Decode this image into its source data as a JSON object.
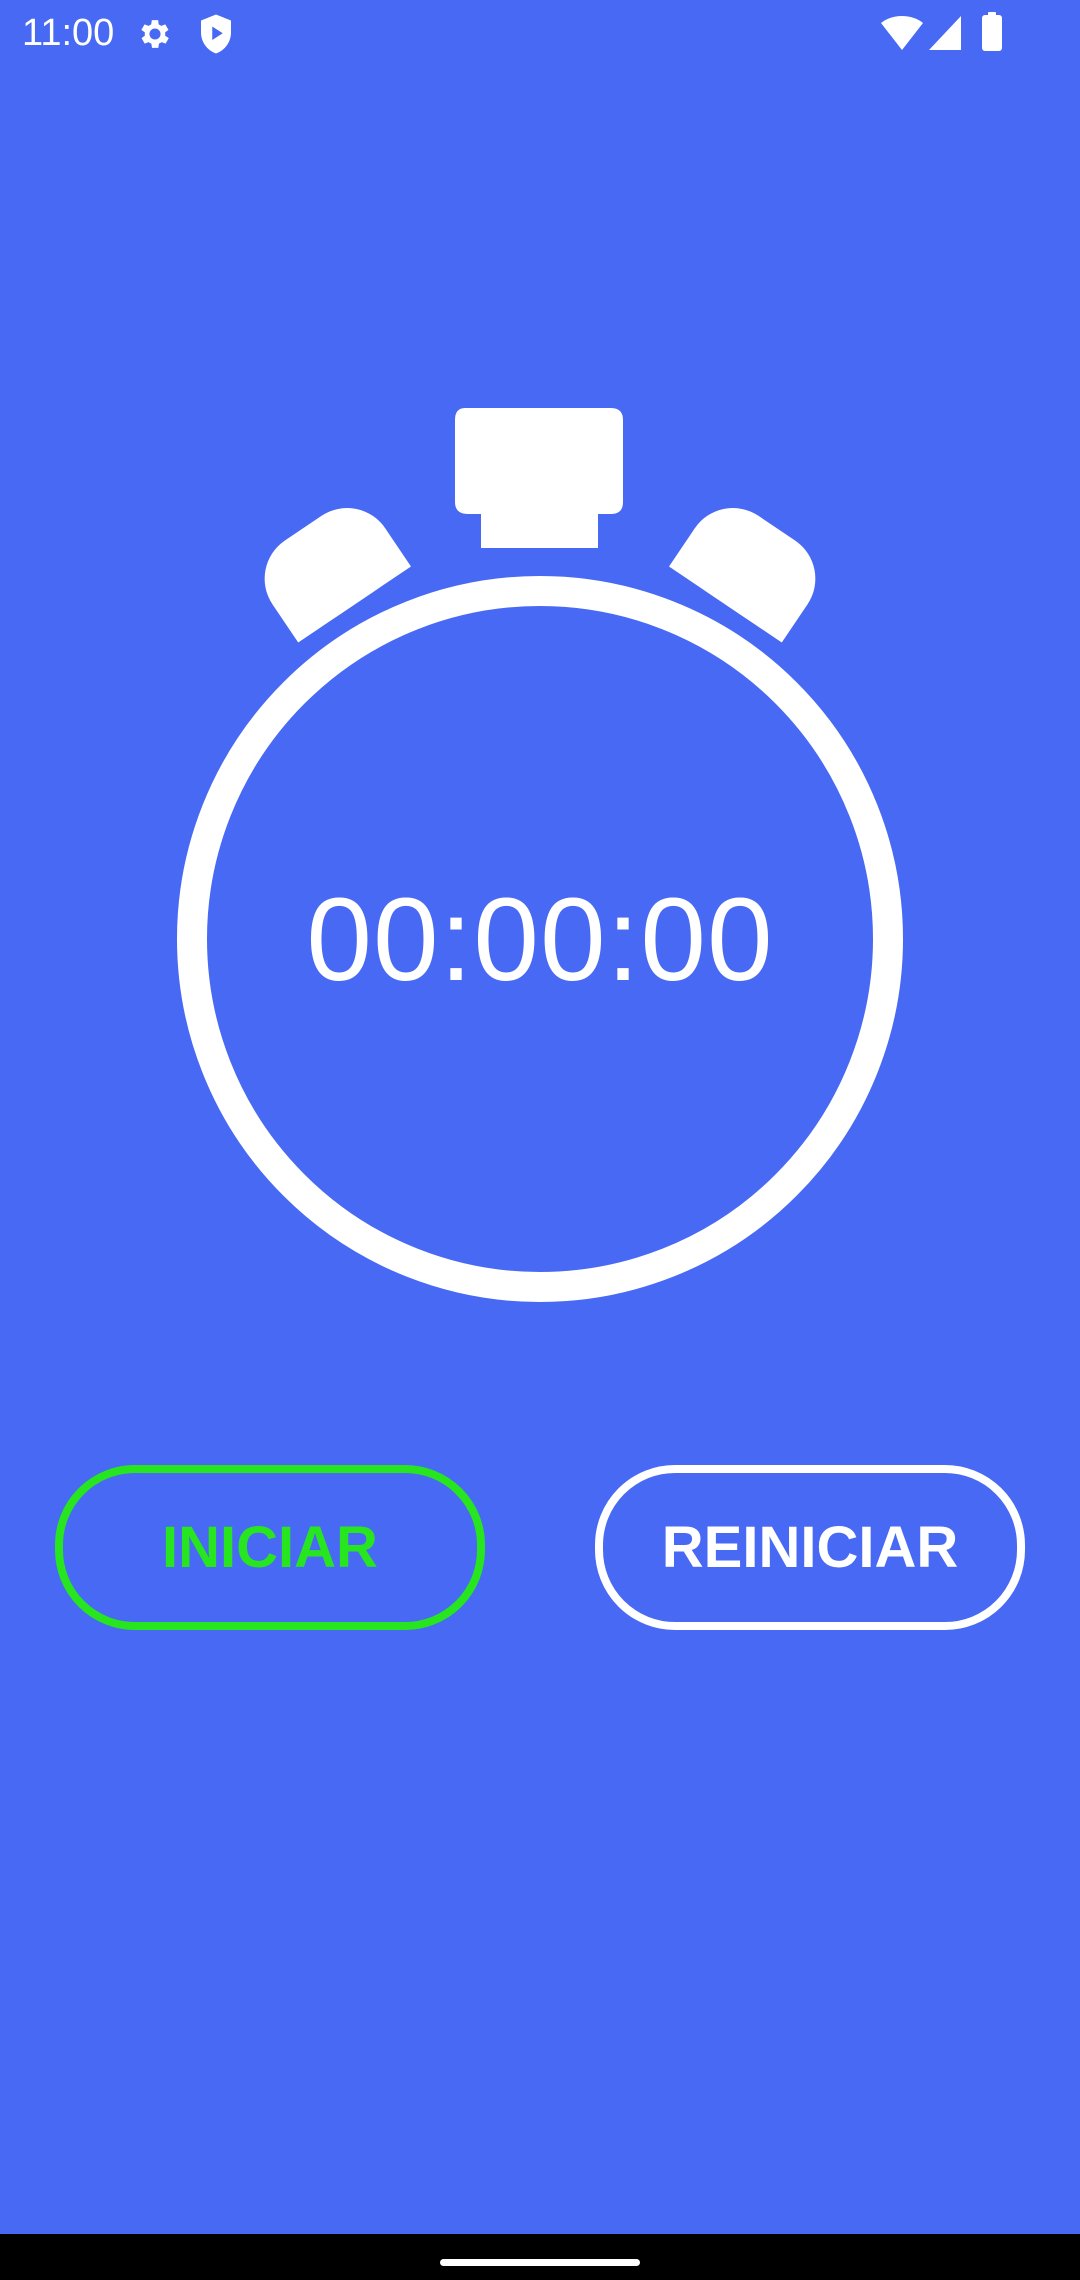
{
  "status_bar": {
    "time": "11:00",
    "left_icons": [
      "settings-gear-icon",
      "shield-play-icon"
    ],
    "right_icons": [
      "wifi-icon",
      "cellular-signal-icon",
      "battery-icon"
    ]
  },
  "stopwatch": {
    "time_display": "00:00:00",
    "icon": "stopwatch-icon"
  },
  "buttons": {
    "start_label": "INICIAR",
    "reset_label": "REINICIAR"
  },
  "colors": {
    "background": "#4869F4",
    "start_accent": "#27E61F",
    "reset_accent": "#FFFFFF",
    "foreground": "#FFFFFF"
  },
  "navigation_bar": {
    "handle": "home-gesture-handle"
  }
}
